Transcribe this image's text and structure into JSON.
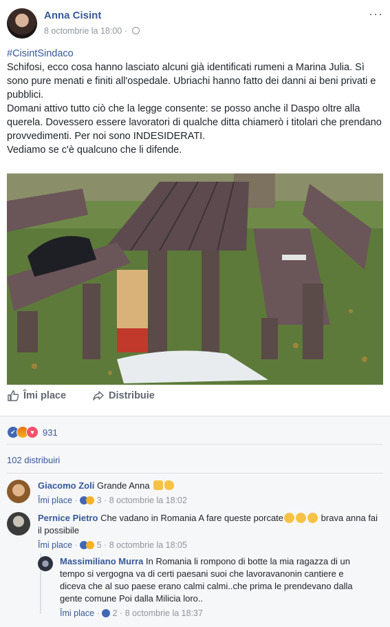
{
  "post": {
    "author": "Anna Cisint",
    "date": "8 octombrie la 18:00 · ",
    "more": "···",
    "hashtag": "#CisintSindaco",
    "paragraphs": [
      "Schifosi, ecco cosa hanno lasciato alcuni già identificati rumeni a Marina Julia. Sì sono pure menati e finiti all'ospedale. Ubriachi hanno fatto dei danni ai beni privati e pubblici.",
      "Domani attivo tutto ciò che la legge consente: se posso anche il Daspo oltre alla querela. Dovessero essere lavoratori di qualche ditta chiamerò i titolari che prendano provvedimenti. Per noi sono INDESIDERATI.",
      "Vediamo se c'è qualcuno che li difende."
    ],
    "like_label": "Îmi place",
    "share_label": "Distribuie"
  },
  "stats": {
    "reaction_count": "931",
    "shares": "102 distribuiri"
  },
  "comments": [
    {
      "name": "Giacomo Zoli",
      "text": "Grande Anna",
      "like": "Îmi place",
      "count": "3",
      "time": "8 octombrie la 18:02"
    },
    {
      "name": "Pernice Pietro",
      "text": "Che vadano in Romania A fare queste porcate",
      "text2": "brava anna fai il possibile",
      "like": "Îmi place",
      "count": "5",
      "time": "8 octombrie la 18:05"
    },
    {
      "name": "Massimiliano Murra",
      "text": "In Romania li rompono di botte la mia ragazza di un tempo si vergogna va di certi paesani suoi che lavoravanonin cantiere e diceva che al suo paese erano calmi calmi..che prima le prendevano dalla gente comune Poi dalla Milicia loro..",
      "like": "Îmi place",
      "count": "2",
      "time": "8 octombrie la 18:37"
    }
  ],
  "colors": {
    "link": "#365899",
    "meta": "#90949c",
    "like": "#4267b2"
  }
}
